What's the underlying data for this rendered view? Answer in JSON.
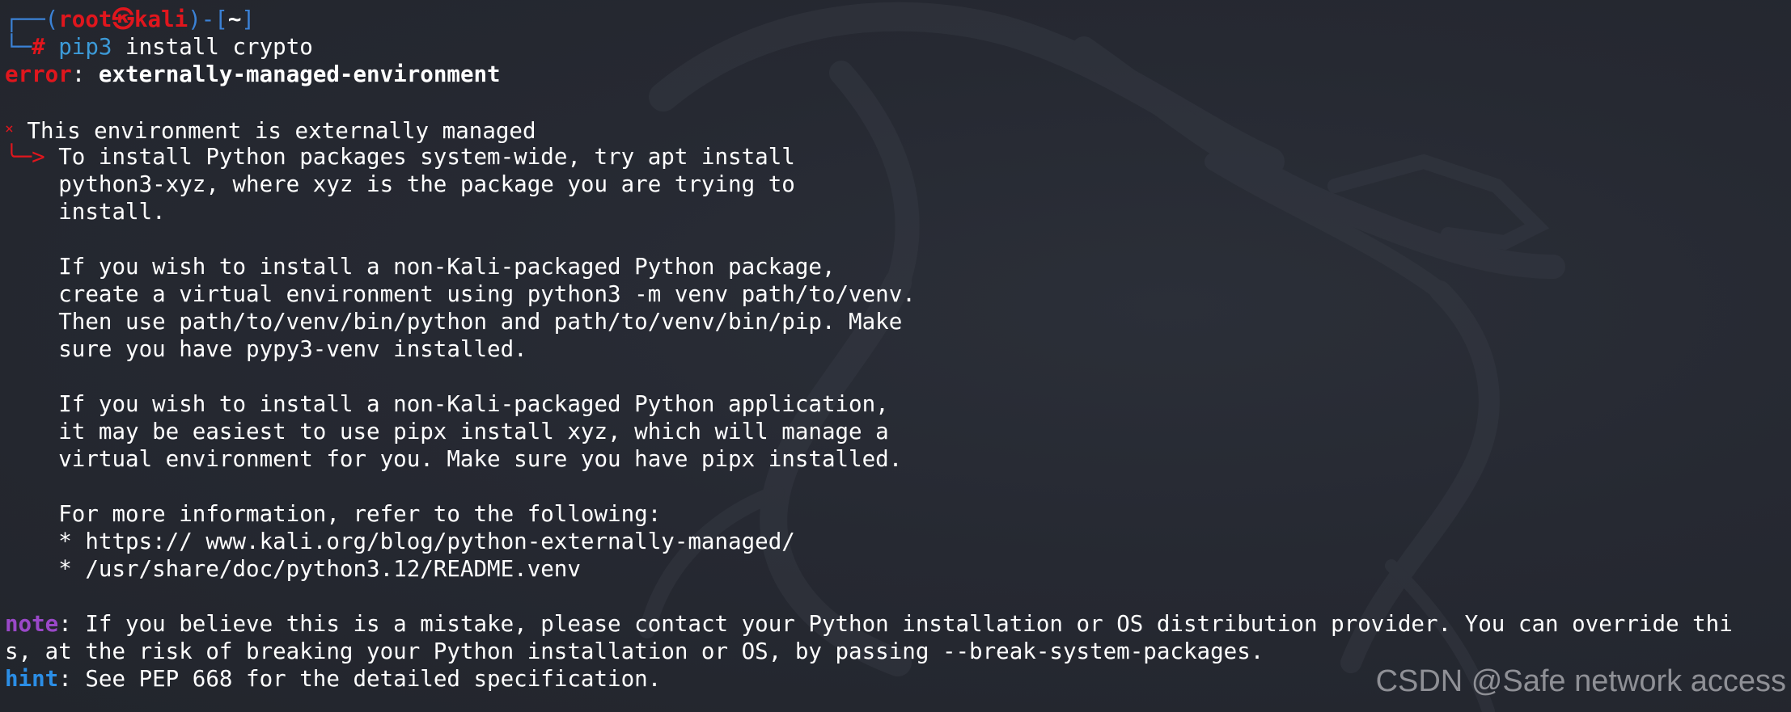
{
  "prompt": {
    "corner_top": "┌──(",
    "user": "root㉿kali",
    "close_paren": ")-[",
    "cwd": "~",
    "close_bracket": "]",
    "corner_bottom": "└─",
    "hash": "#",
    "command": "pip3",
    "args": " install crypto"
  },
  "error": {
    "label": "error",
    "separator": ": ",
    "message": "externally-managed-environment"
  },
  "details": {
    "x_mark": "×",
    "heading": " This environment is externally managed",
    "arrow": "╰─>",
    "lines": [
      " To install Python packages system-wide, try apt install",
      "    python3-xyz, where xyz is the package you are trying to",
      "    install.",
      "",
      "    If you wish to install a non-Kali-packaged Python package,",
      "    create a virtual environment using python3 -m venv path/to/venv.",
      "    Then use path/to/venv/bin/python and path/to/venv/bin/pip. Make",
      "    sure you have pypy3-venv installed.",
      "",
      "    If you wish to install a non-Kali-packaged Python application,",
      "    it may be easiest to use pipx install xyz, which will manage a",
      "    virtual environment for you. Make sure you have pipx installed.",
      "",
      "    For more information, refer to the following:",
      "    * https:// www.kali.org/blog/python-externally-managed/",
      "    * /usr/share/doc/python3.12/README.venv"
    ]
  },
  "note": {
    "label": "note",
    "line1": ": If you believe this is a mistake, please contact your Python installation or OS distribution provider. You can override thi",
    "line2": "s, at the risk of breaking your Python installation or OS, by passing --break-system-packages."
  },
  "hint": {
    "label": "hint",
    "text": ": See PEP 668 for the detailed specification."
  },
  "watermark": "CSDN @Safe network access",
  "colors": {
    "background": "#24272f",
    "prompt_blue": "#3b82d6",
    "prompt_red": "#e0161d",
    "note_purple": "#9a48c8",
    "hint_blue": "#2b8ee6"
  }
}
